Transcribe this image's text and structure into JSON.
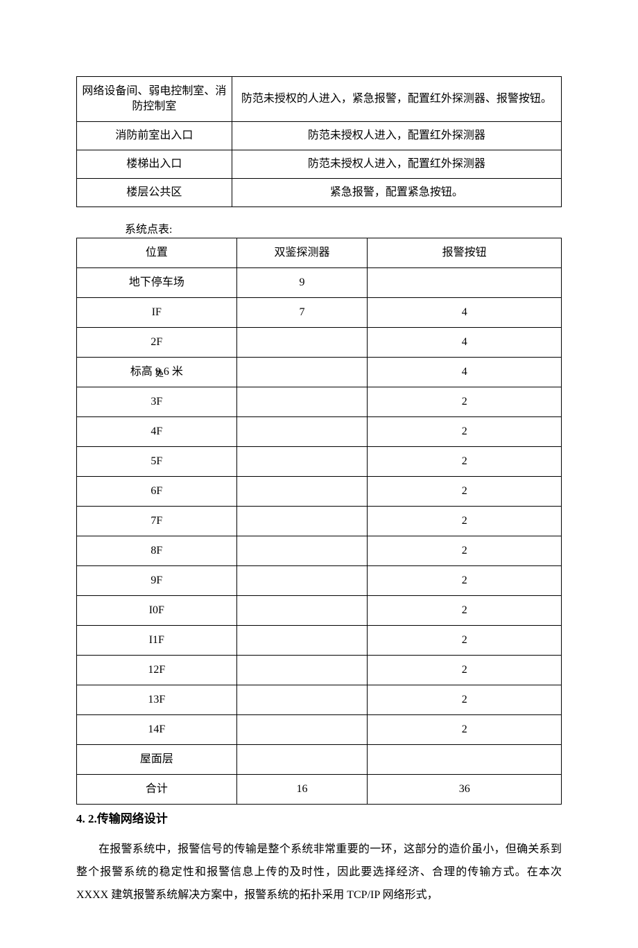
{
  "table1": {
    "rows": [
      {
        "c1": "网络设备间、弱电控制室、消防控制室",
        "c2": "防范未授权的人进入，紧急报警，配置红外探测器、报警按钮。"
      },
      {
        "c1": "消防前室出入口",
        "c2": "防范未授权人进入，配置红外探测器"
      },
      {
        "c1": "楼梯出入口",
        "c2": "防范未授权人进入，配置红外探测器"
      },
      {
        "c1": "楼层公共区",
        "c2": "紧急报警，配置紧急按钮。"
      }
    ]
  },
  "table2_label": "系统点表:",
  "table2": {
    "headers": [
      "位置",
      "双鉴探测器",
      "报警按钮"
    ],
    "rows": [
      [
        "地下停车场",
        "9",
        ""
      ],
      [
        "IF",
        "7",
        "4"
      ],
      [
        "2F",
        "",
        "4"
      ],
      [
        "标高 9.6 米",
        "",
        "4"
      ],
      [
        "3F",
        "",
        "2"
      ],
      [
        "4F",
        "",
        "2"
      ],
      [
        "5F",
        "",
        "2"
      ],
      [
        "6F",
        "",
        "2"
      ],
      [
        "7F",
        "",
        "2"
      ],
      [
        "8F",
        "",
        "2"
      ],
      [
        "9F",
        "",
        "2"
      ],
      [
        "I0F",
        "",
        "2"
      ],
      [
        "I1F",
        "",
        "2"
      ],
      [
        "12F",
        "",
        "2"
      ],
      [
        "13F",
        "",
        "2"
      ],
      [
        "14F",
        "",
        "2"
      ],
      [
        "屋面层",
        "",
        ""
      ],
      [
        "合计",
        "16",
        "36"
      ]
    ],
    "annotation": "处"
  },
  "heading": {
    "num": "4. 2.",
    "text": "传输网络设计"
  },
  "paragraph": "在报警系统中，报警信号的传输是整个系统非常重要的一环，这部分的造价虽小，但确关系到整个报警系统的稳定性和报警信息上传的及时性，因此要选择经济、合理的传输方式。在本次 XXXX 建筑报警系统解决方案中，报警系统的拓扑采用 TCP/IP 网络形式，"
}
